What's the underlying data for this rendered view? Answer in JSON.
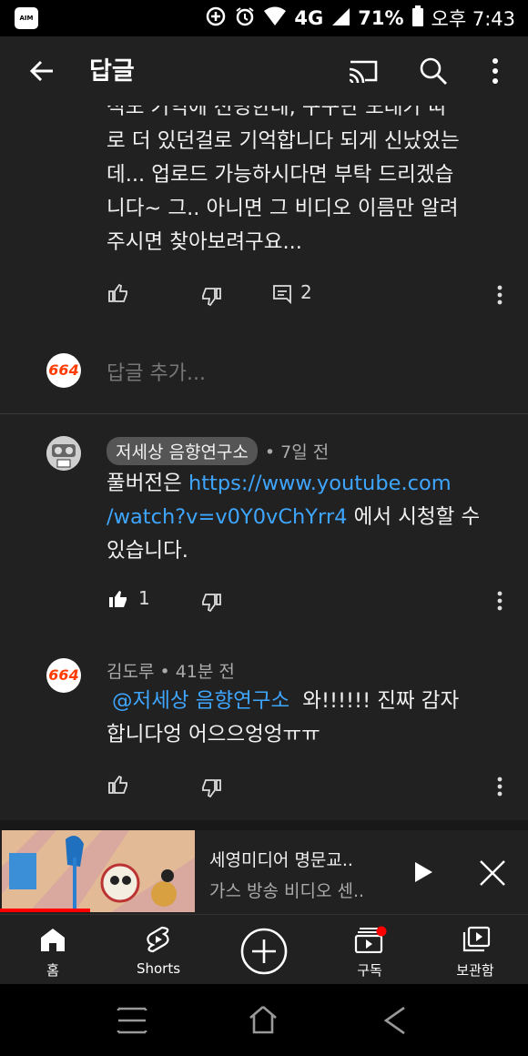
{
  "status_bar": {
    "app_badge": "AIM",
    "network": "4G",
    "battery": "71%",
    "time": "오후 7:43"
  },
  "app_bar": {
    "title": "답글",
    "icons": [
      "back-arrow-icon",
      "cast-icon",
      "search-icon",
      "more-vert-icon"
    ]
  },
  "comments": [
    {
      "text_lines": [
        "석도 기억에 선명한데, 구구단 노래가 따",
        "로 더 있던걸로 기억합니다 되게 신났었는",
        "데... 업로드 가능하시다면 부탁 드리겠습",
        "니다~ 그.. 아니면 그 비디오 이름만 알려",
        "주시면 찾아보려구요..."
      ],
      "reply_count": "2"
    },
    {
      "author": "저세상 음향연구소",
      "time": "• 7일 전",
      "text_prefix": "풀버전은 ",
      "link_line1": "https://www.youtube.com",
      "link_line2": "/watch?v=v0Y0vChYrr4",
      "text_suffix_line2": " 에서 시청할 수",
      "text_line3": "있습니다.",
      "likes": "1"
    },
    {
      "author": "김도루",
      "time": "• 41분 전",
      "mention": "@저세상 음향연구소",
      "text_line1": "와!!!!!! 진짜 감자",
      "text_line2": "합니다엉 어으으엉엉ㅠㅠ"
    }
  ],
  "reply_box": {
    "avatar_text": "664",
    "placeholder": "답글 추가..."
  },
  "miniplayer": {
    "title": "세영미디어 명문교..",
    "subtitle": "가스 방송 비디오 센..",
    "progress": 0.17
  },
  "bottom_nav": {
    "items": [
      {
        "label": "홈",
        "icon": "home-icon"
      },
      {
        "label": "Shorts",
        "icon": "shorts-icon"
      },
      {
        "label": "",
        "icon": "create-plus-icon"
      },
      {
        "label": "구독",
        "icon": "subscriptions-icon"
      },
      {
        "label": "보관함",
        "icon": "library-icon"
      }
    ]
  },
  "colors": {
    "background": "#212121",
    "link": "#3ea6ff",
    "accent_red": "#ff0000"
  }
}
